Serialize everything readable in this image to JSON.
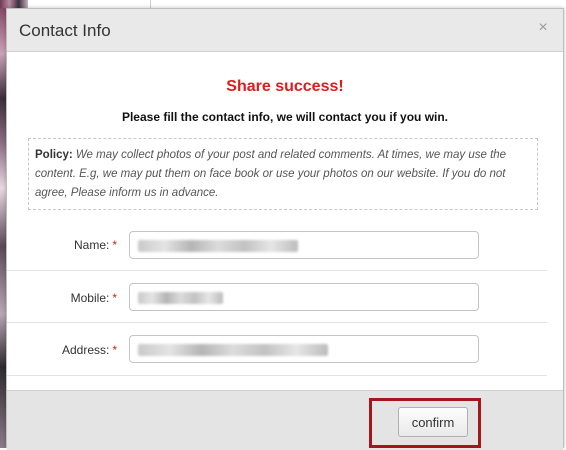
{
  "modal": {
    "title": "Contact Info",
    "close_label": "×",
    "success_message": "Share success!",
    "instruction": "Please fill the contact info, we will contact you if you win.",
    "policy": {
      "label": "Policy:",
      "text": " We may collect photos of your post and related comments. At times, we may use the content. E.g, we may put them on face book or use your photos on our website. If you do not agree, Please inform us in advance."
    },
    "fields": [
      {
        "label": "Name:",
        "required_mark": "*",
        "value_hidden": true
      },
      {
        "label": "Mobile:",
        "required_mark": "*",
        "value_hidden": true
      },
      {
        "label": "Address:",
        "required_mark": "*",
        "value_hidden": true
      }
    ],
    "confirm_label": "confirm",
    "colors": {
      "success": "#e01b1b",
      "required": "#d02020",
      "highlight_box": "#a3161c",
      "header_bg": "#e9e9e9",
      "footer_bg": "#e4e4e4"
    }
  }
}
